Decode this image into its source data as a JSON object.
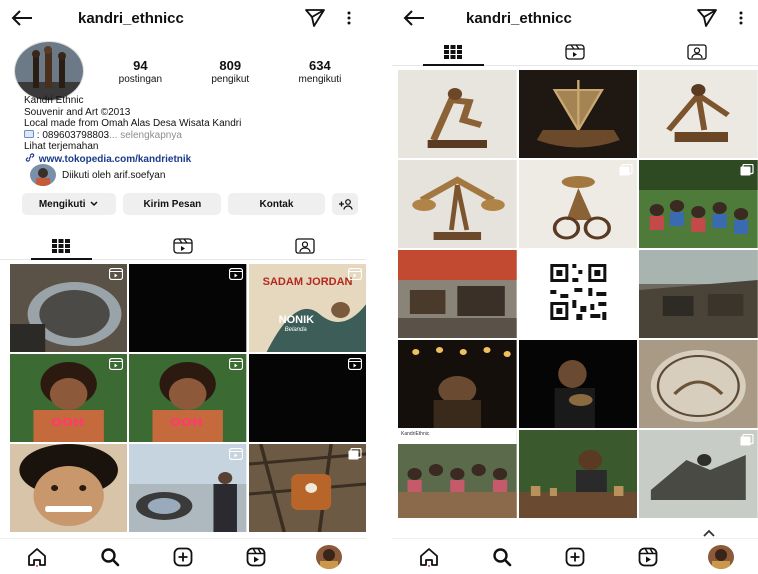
{
  "username": "kandri_ethnicc",
  "stats": [
    {
      "num": "94",
      "label": "postingan"
    },
    {
      "num": "809",
      "label": "pengikut"
    },
    {
      "num": "634",
      "label": "mengikuti"
    }
  ],
  "bio": {
    "name": "Kandri Ethnic",
    "line1": "Souvenir and Art ©2013",
    "line2": "Local made from Omah Alas Desa Wisata Kandri",
    "phone": ": 089603798803",
    "more": "... selengkapnya",
    "translate": "Lihat terjemahan",
    "link": "www.tokopedia.com/kandrietnik",
    "followed_by": "Diikuti oleh arif.soefyan"
  },
  "buttons": {
    "following": "Mengikuti",
    "message": "Kirim Pesan",
    "contact": "Kontak"
  },
  "left_grid_text": {
    "poster_top": "SADAM JORDAN",
    "poster_bottom": "NONIK",
    "poster_small": "Belanda"
  },
  "right_grid_text": {
    "caption": "KandriEthnic"
  },
  "colors": {
    "link": "#1a3a8a",
    "button_bg": "#efefef",
    "muted": "#8e8e8e"
  }
}
